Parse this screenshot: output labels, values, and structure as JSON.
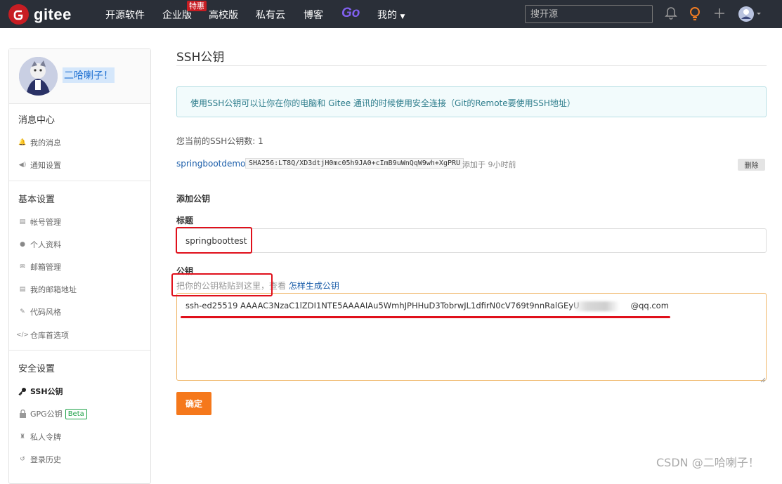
{
  "nav": {
    "brand": "gitee",
    "items": [
      "开源软件",
      "企业版",
      "高校版",
      "私有云",
      "博客"
    ],
    "enterprise_badge": "特惠",
    "go_label": "Go",
    "mine_label": "我的",
    "search_placeholder": "搜开源"
  },
  "sidebar": {
    "username": "二哈喇子！",
    "sections": {
      "messages": "消息中心",
      "basic": "基本设置",
      "security": "安全设置"
    },
    "message_items": [
      "我的消息",
      "通知设置"
    ],
    "basic_items": [
      "帐号管理",
      "个人资料",
      "邮箱管理",
      "我的邮箱地址",
      "代码风格",
      "仓库首选项"
    ],
    "security_items": [
      "SSH公钥",
      "GPG公钥",
      "私人令牌",
      "登录历史"
    ],
    "beta_label": "Beta"
  },
  "main": {
    "title": "SSH公钥",
    "info": "使用SSH公钥可以让你在你的电脑和 Gitee 通讯的时候使用安全连接（Git的Remote要使用SSH地址）",
    "key_count": "您当前的SSH公钥数: 1",
    "key": {
      "name": "springbootdemo",
      "fingerprint": "SHA256:LT8Q/XD3dtjH0mc05h9JA0+cImB9uWnQqW9wh+XgPRU",
      "added": "添加于 9小时前",
      "delete_label": "删除"
    },
    "add_heading": "添加公钥",
    "title_label": "标题",
    "title_value": "springboottest",
    "key_label": "公钥",
    "hint_text": "把你的公钥粘贴到这里，",
    "hint_view": "查看",
    "hint_link": "怎样生成公钥",
    "key_value": "ssh-ed25519 AAAAC3NzaC1lZDI1NTE5AAAAIAu5WmhJPHHuD3TobrwJL1dfirN0cV769t9nnRalGEyU                    @qq.com",
    "submit_label": "确定"
  },
  "watermark": "CSDN @二哈喇子！",
  "colors": {
    "nav_bg": "#2a2f38",
    "brand_red": "#c71d23",
    "go_purple": "#8160ef",
    "submit_orange": "#f5781b",
    "annotation_red": "#e0101b",
    "link_blue": "#1b5eaa"
  }
}
